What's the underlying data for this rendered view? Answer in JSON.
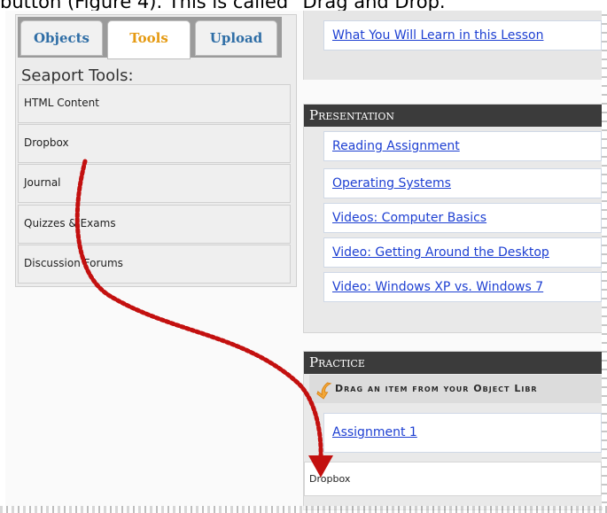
{
  "document": {
    "caption_fragment": "button (Figure 4). This is called \"Drag and Drop."
  },
  "library": {
    "tabs": [
      {
        "label": "Objects",
        "state": "normal"
      },
      {
        "label": "Tools",
        "state": "selected"
      },
      {
        "label": "Upload",
        "state": "normal"
      }
    ],
    "title": "Seaport Tools:",
    "items": [
      {
        "label": "HTML Content"
      },
      {
        "label": "Dropbox"
      },
      {
        "label": "Journal"
      },
      {
        "label": "Quizzes & Exams"
      },
      {
        "label": "Discussion Forums"
      }
    ]
  },
  "lesson": {
    "top_link": "What You Will Learn in this Lesson",
    "presentation": {
      "title": "Presentation",
      "items": [
        {
          "label": "Reading Assignment"
        },
        {
          "label": "Operating Systems"
        },
        {
          "label": "Videos: Computer Basics"
        },
        {
          "label": "Video: Getting Around the Desktop"
        },
        {
          "label": "Video: Windows XP vs. Windows 7"
        }
      ]
    },
    "practice": {
      "title": "Practice",
      "instruction": "Drag an item from your Object Libr",
      "items": [
        {
          "label": "Assignment 1"
        }
      ],
      "dropped_item": "Dropbox"
    }
  },
  "icons": {
    "instruction_arrow": "orange-down-left-arrow-icon",
    "drag_indicator": "red-dotted-arrow-icon"
  },
  "colors": {
    "tab_selected": "#e59a12",
    "link_blue": "#1d3fd2",
    "section_header": "#3b3b3b",
    "drag_arrow": "#c3100f"
  }
}
